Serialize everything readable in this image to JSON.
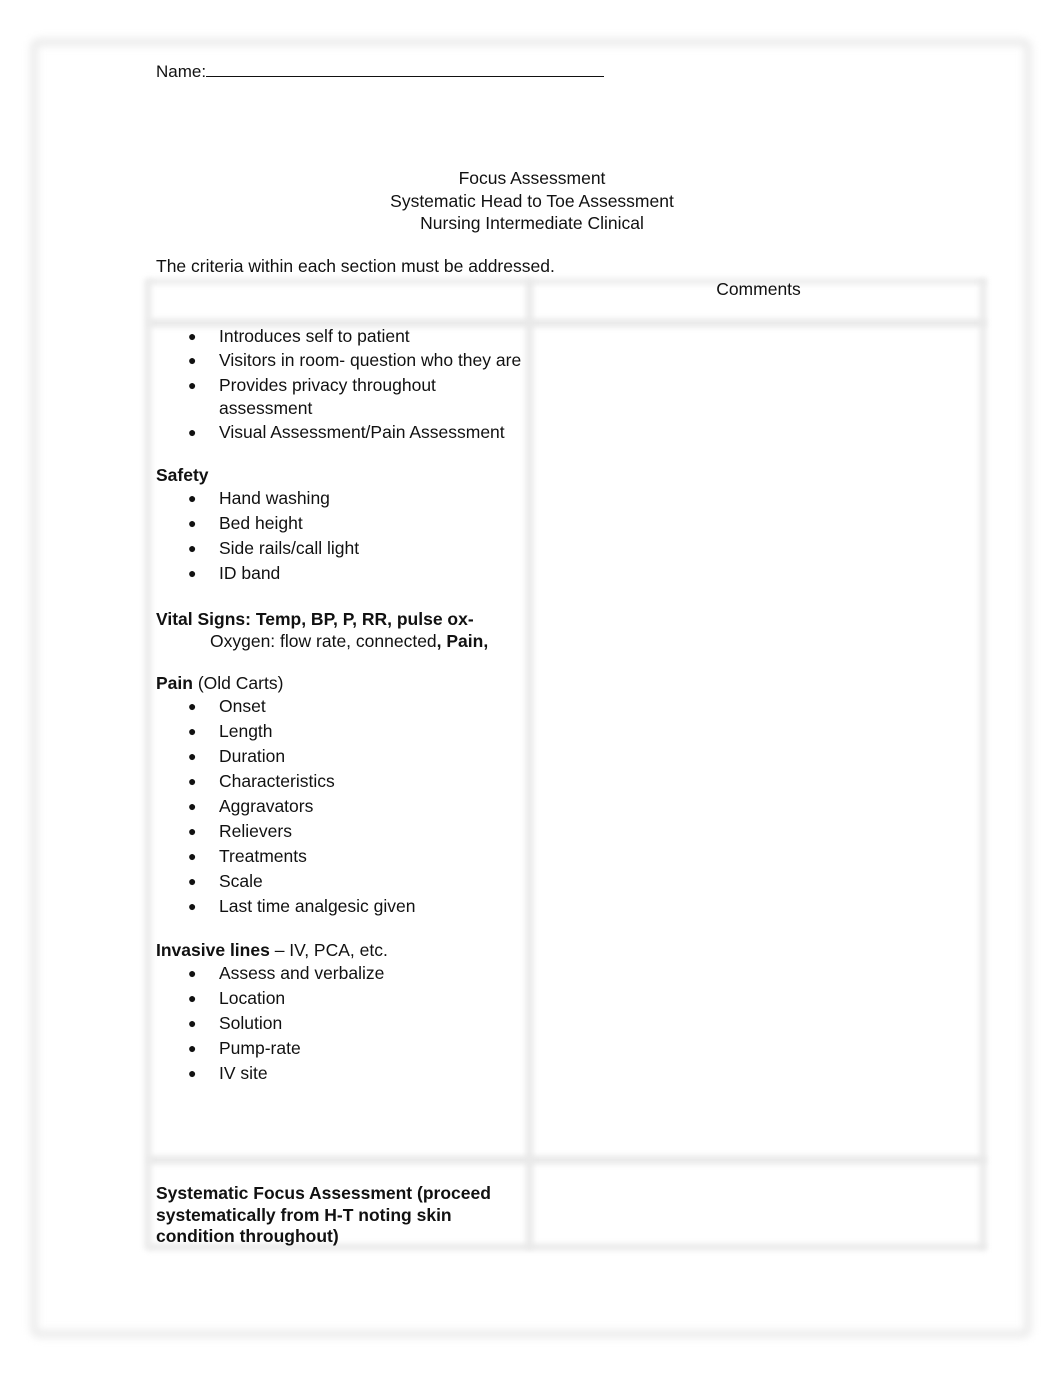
{
  "document": {
    "name_label": "Name:",
    "title_lines": [
      "Focus Assessment",
      "Systematic Head to Toe Assessment",
      "Nursing Intermediate Clinical"
    ],
    "intro_text": "The criteria within each section must be addressed.",
    "table": {
      "header": {
        "criteria": "",
        "comments": "Comments"
      },
      "intro_items": [
        "Introduces self to patient",
        "Visitors in room- question who they are",
        "Provides privacy throughout assessment",
        "Visual Assessment/Pain Assessment"
      ],
      "safety": {
        "heading": "Safety",
        "items": [
          "Hand washing",
          "Bed height",
          "Side rails/call light",
          "ID band"
        ]
      },
      "vital_signs": {
        "heading": "Vital Signs: Temp, BP, P, RR, pulse ox-",
        "subline_normal": "Oxygen: flow rate, connected",
        "subline_bold": ", Pain,"
      },
      "pain": {
        "heading": "Pain",
        "heading_suffix": " (Old Carts)",
        "items": [
          "Onset",
          "Length",
          "Duration",
          "Characteristics",
          "Aggravators",
          "Relievers",
          "Treatments",
          "Scale",
          "Last time analgesic given"
        ]
      },
      "invasive_lines": {
        "heading": "Invasive lines",
        "heading_suffix": " – IV, PCA, etc.",
        "items": [
          "Assess and verbalize",
          "Location",
          "Solution",
          "Pump-rate",
          "IV site"
        ]
      },
      "systematic_focus": "Systematic Focus Assessment (proceed systematically from H-T noting skin condition throughout)",
      "comments_cells": [
        "",
        ""
      ]
    },
    "bullet_glyph": "●"
  }
}
